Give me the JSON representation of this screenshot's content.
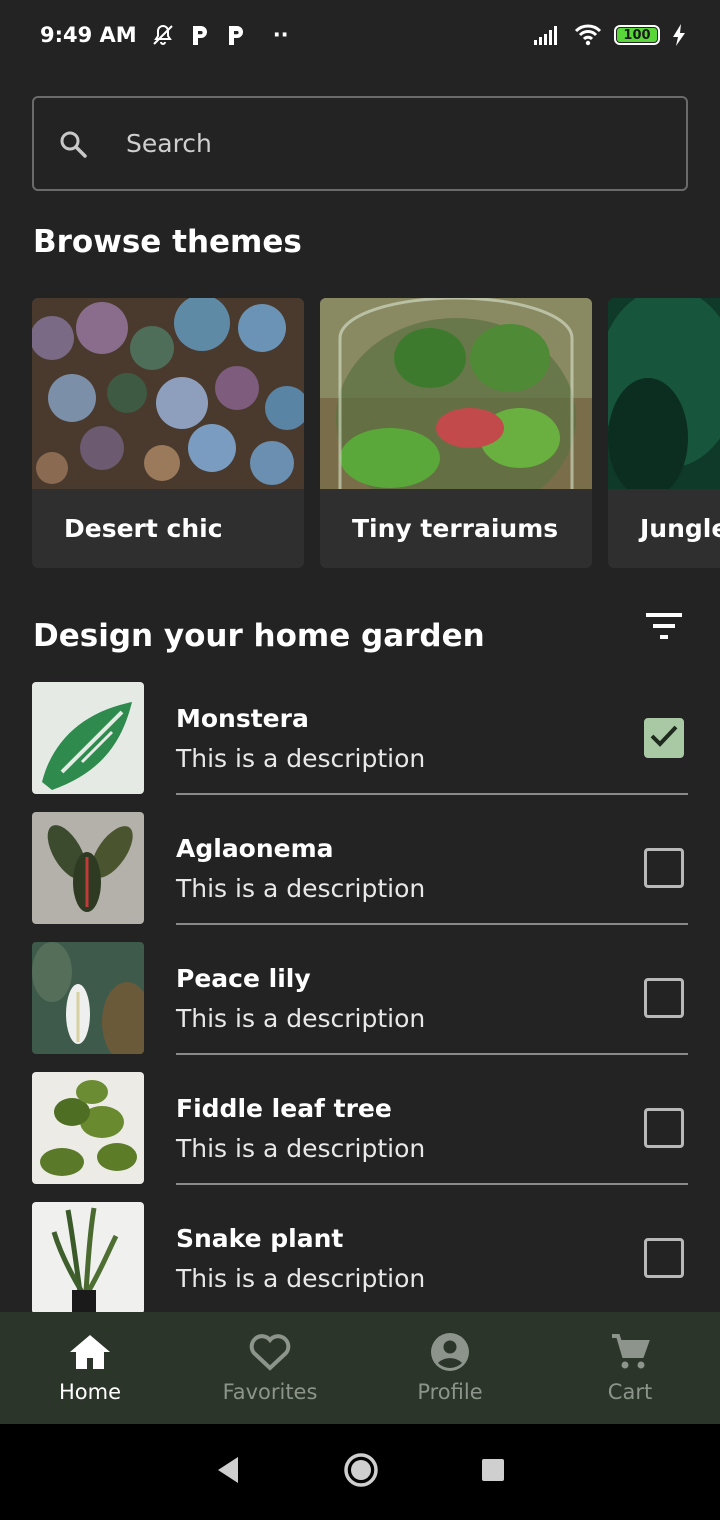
{
  "status_bar": {
    "time": "9:49 AM",
    "dots": "··",
    "battery": "100",
    "icons": [
      "bell-off-icon",
      "parking-icon",
      "parking-icon",
      "signal-icon",
      "wifi-icon",
      "battery-icon",
      "charging-icon"
    ]
  },
  "search": {
    "placeholder": "Search",
    "value": ""
  },
  "themes": {
    "title": "Browse themes",
    "items": [
      {
        "label": "Desert chic"
      },
      {
        "label": "Tiny terraiums"
      },
      {
        "label": "Jungle"
      }
    ]
  },
  "garden": {
    "title": "Design your home garden",
    "plants": [
      {
        "name": "Monstera",
        "description": "This is a description",
        "checked": true
      },
      {
        "name": "Aglaonema",
        "description": "This is a description",
        "checked": false
      },
      {
        "name": "Peace lily",
        "description": "This is a description",
        "checked": false
      },
      {
        "name": "Fiddle leaf tree",
        "description": "This is a description",
        "checked": false
      },
      {
        "name": "Snake plant",
        "description": "This is a description",
        "checked": false
      }
    ]
  },
  "bottom_nav": {
    "items": [
      {
        "label": "Home",
        "active": true
      },
      {
        "label": "Favorites",
        "active": false
      },
      {
        "label": "Profile",
        "active": false
      },
      {
        "label": "Cart",
        "active": false
      }
    ]
  },
  "colors": {
    "background": "#232323",
    "card": "#2f2f2f",
    "nav_bar": "#2b3529",
    "checkbox_checked": "#a9c9a4",
    "nav_inactive": "#8d948b"
  }
}
